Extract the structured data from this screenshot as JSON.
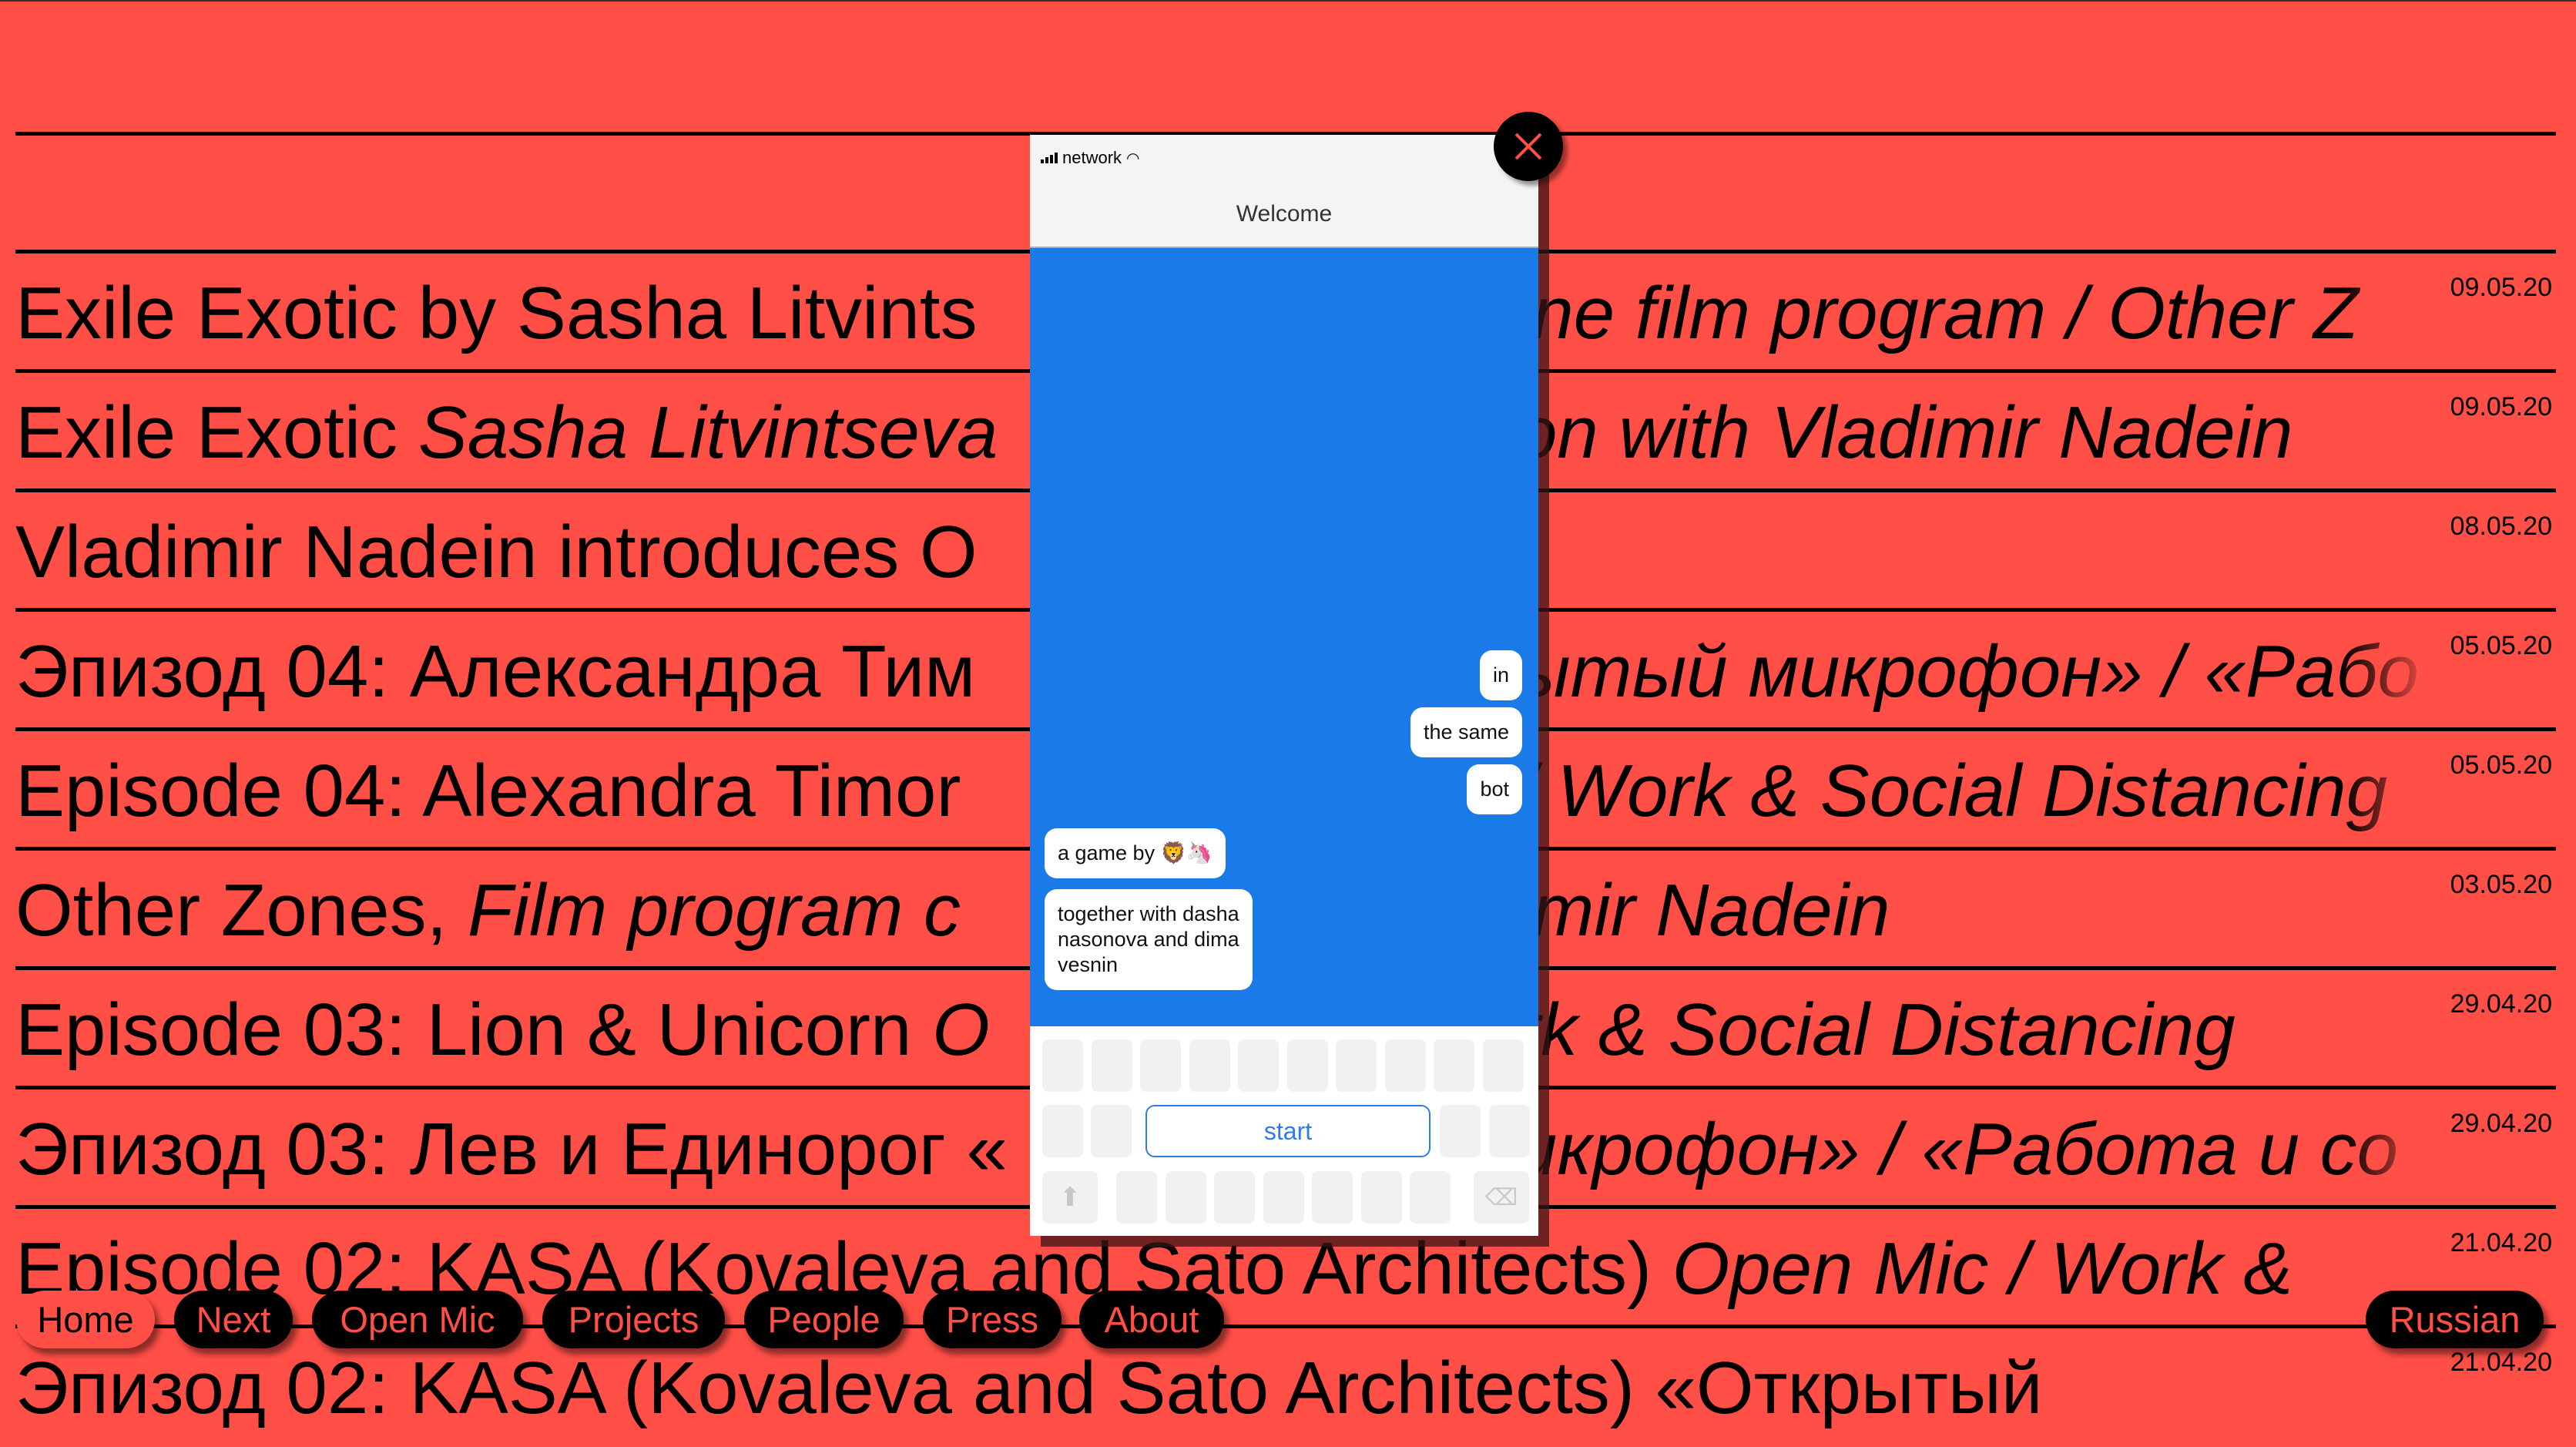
{
  "rows": [
    {
      "left": "Exile Exotic by Sasha Litvints",
      "left_italic": "",
      "right": "ine film program / Other Z",
      "date": "09.05.20"
    },
    {
      "left": "Exile Exotic ",
      "left_italic": "Sasha Litvintseva",
      "right": "on with Vladimir Nadein",
      "date": "09.05.20"
    },
    {
      "left": "Vladimir Nadein introduces O",
      "left_italic": "",
      "right": "",
      "date": "08.05.20"
    },
    {
      "left": "Эпизод 04: Александра Тим",
      "left_italic": "",
      "right": "ытый микрофон» / «Рабо",
      "date": "05.05.20"
    },
    {
      "left": "Episode 04: Alexandra Timor",
      "left_italic": "",
      "right": "/ Work & Social Distancing",
      "date": "05.05.20"
    },
    {
      "left": "Other Zones, ",
      "left_italic": "Film program c",
      "right": "imir Nadein",
      "date": "03.05.20"
    },
    {
      "left": "Episode 03: Lion & Unicorn ",
      "left_italic": "O",
      "right": "rk & Social Distancing",
      "date": "29.04.20"
    },
    {
      "left": "Эпизод 03: Лев и Единорог «",
      "left_italic": "",
      "right": "икрофон» / «Работа и со",
      "date": "29.04.20"
    },
    {
      "left": "Episode 02: KASA (Kovaleva and Sato Architects) ",
      "left_italic": "Open Mic / Work &",
      "right": "",
      "date": "21.04.20"
    },
    {
      "left": "Эпизод 02: KASA (Kovaleva and Sato Architects) «Открытый",
      "left_italic": "",
      "right": "",
      "date": "21.04.20"
    }
  ],
  "phone": {
    "status_network": "network",
    "header_title": "Welcome",
    "messages": [
      "in",
      "the same",
      "bot",
      "a game by 🦁🦄",
      "together with dasha nasonova and dima vesnin"
    ],
    "start_label": "start",
    "chat_color": "#1a7ae8"
  },
  "nav": {
    "items": [
      "Home",
      "Next",
      "Open Mic",
      "Projects",
      "People",
      "Press",
      "About"
    ],
    "active": "Home",
    "language": "Russian"
  },
  "colors": {
    "background": "#ff4f47",
    "text": "#000000"
  }
}
